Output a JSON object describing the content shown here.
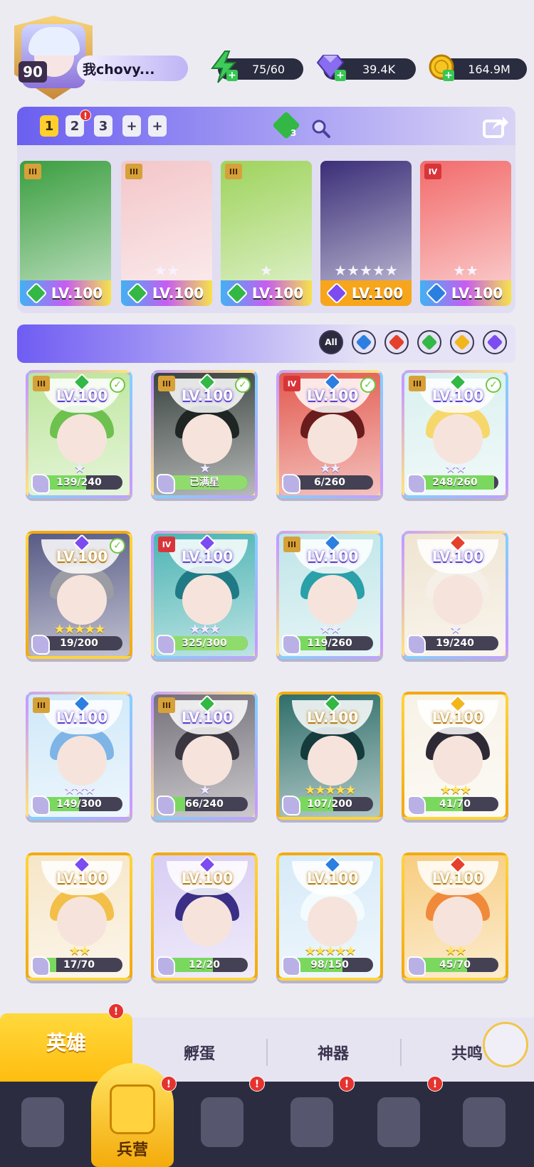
{
  "player": {
    "level": "90",
    "name": "我chovy..."
  },
  "resources": {
    "energy": "75/60",
    "gems": "39.4K",
    "coins": "164.9M"
  },
  "team": {
    "tabs": [
      "1",
      "2",
      "3",
      "+",
      "+"
    ],
    "active_tab": 0,
    "tab2_badge": "!",
    "element_chip_count": "3",
    "heroes": [
      {
        "rank": "III",
        "level": "LV.100",
        "stars": "",
        "element": "#33b846",
        "bg": "#3a9e3f"
      },
      {
        "rank": "III",
        "level": "LV.100",
        "stars": "★★",
        "element": "#33b846",
        "bg": "#f3c6c9"
      },
      {
        "rank": "III",
        "level": "LV.100",
        "stars": "★",
        "element": "#33b846",
        "bg": "#9ed35c"
      },
      {
        "rank": "",
        "level": "LV.100",
        "stars": "★★★★★",
        "element": "#7c4cf0",
        "bg": "#3b2e78"
      },
      {
        "rank": "IV",
        "level": "LV.100",
        "stars": "★★",
        "element": "#2b7fe0",
        "bg": "#f26b6b"
      }
    ]
  },
  "filters": {
    "all_label": "All",
    "elements": [
      "#2b7fe0",
      "#e5402c",
      "#33b846",
      "#f2b61c",
      "#7c4cf0"
    ]
  },
  "heroes": [
    {
      "rank": "III",
      "level": "LV.100",
      "stars": "★",
      "progress": "139/240",
      "fill": 0.58,
      "element": "#33b846",
      "check": true,
      "gold": false,
      "bg": "#bde59c",
      "hair": "#6ec14f"
    },
    {
      "rank": "III",
      "level": "LV.100",
      "stars": "★",
      "progress": "已满星",
      "fill": 1.0,
      "element": "#33b846",
      "check": true,
      "gold": false,
      "bg": "#3a4340",
      "hair": "#1e2522"
    },
    {
      "rank": "IV",
      "level": "LV.100",
      "stars": "★★",
      "progress": "6/260",
      "fill": 0.02,
      "element": "#2b7fe0",
      "check": true,
      "gold": false,
      "bg": "#e25a4f",
      "hair": "#6a1c1c"
    },
    {
      "rank": "III",
      "level": "LV.100",
      "stars": "★★",
      "progress": "248/260",
      "fill": 0.95,
      "element": "#33b846",
      "check": true,
      "gold": false,
      "bg": "#d9f0ef",
      "hair": "#f6d76b"
    },
    {
      "rank": "",
      "level": "LV.100",
      "stars": "★★★★★",
      "progress": "19/200",
      "fill": 0.1,
      "element": "#7c4cf0",
      "check": true,
      "gold": true,
      "bg": "#595b86",
      "hair": "#9c9ca4"
    },
    {
      "rank": "IV",
      "level": "LV.100",
      "stars": "★★★",
      "progress": "325/300",
      "fill": 1.0,
      "element": "#7c4cf0",
      "check": false,
      "gold": false,
      "bg": "#4db4b4",
      "hair": "#1f7a86"
    },
    {
      "rank": "III",
      "level": "LV.100",
      "stars": "★★",
      "progress": "119/260",
      "fill": 0.46,
      "element": "#2b7fe0",
      "check": false,
      "gold": false,
      "bg": "#bfe5e8",
      "hair": "#2aa0a8"
    },
    {
      "rank": "",
      "level": "LV.100",
      "stars": "★",
      "progress": "19/240",
      "fill": 0.08,
      "element": "#e5402c",
      "check": false,
      "gold": false,
      "bg": "#efe4d1",
      "hair": "#f4f0e8"
    },
    {
      "rank": "III",
      "level": "LV.100",
      "stars": "★★★",
      "progress": "149/300",
      "fill": 0.5,
      "element": "#2b7fe0",
      "check": false,
      "gold": false,
      "bg": "#cfe8f8",
      "hair": "#7fb5e6"
    },
    {
      "rank": "III",
      "level": "LV.100",
      "stars": "★",
      "progress": "66/240",
      "fill": 0.28,
      "element": "#33b846",
      "check": false,
      "gold": false,
      "bg": "#75707a",
      "hair": "#3a3640"
    },
    {
      "rank": "",
      "level": "LV.100",
      "stars": "★★★★★",
      "progress": "107/200",
      "fill": 0.54,
      "element": "#33b846",
      "check": false,
      "gold": true,
      "bg": "#2f6e6a",
      "hair": "#163b3c"
    },
    {
      "rank": "",
      "level": "LV.100",
      "stars": "★★★",
      "progress": "41/70",
      "fill": 0.59,
      "element": "#f2b61c",
      "check": false,
      "gold": true,
      "bg": "#f7f2e6",
      "hair": "#2e2a35"
    },
    {
      "rank": "",
      "level": "LV.100",
      "stars": "★★",
      "progress": "17/70",
      "fill": 0.24,
      "element": "#7c4cf0",
      "check": false,
      "gold": true,
      "bg": "#f6e6c8",
      "hair": "#f2c04a"
    },
    {
      "rank": "",
      "level": "LV.100",
      "stars": "",
      "progress": "12/20",
      "fill": 0.6,
      "element": "#7c4cf0",
      "check": false,
      "gold": true,
      "bg": "#d8cdf3",
      "hair": "#3a2e86"
    },
    {
      "rank": "",
      "level": "LV.100",
      "stars": "★★★★★",
      "progress": "98/150",
      "fill": 0.65,
      "element": "#2b7fe0",
      "check": false,
      "gold": true,
      "bg": "#d6eaf8",
      "hair": "#f4fbff"
    },
    {
      "rank": "",
      "level": "LV.100",
      "stars": "★★",
      "progress": "45/70",
      "fill": 0.64,
      "element": "#e5402c",
      "check": false,
      "gold": true,
      "bg": "#f7cd80",
      "hair": "#f08a3a"
    }
  ],
  "tabs": {
    "heroes": "英雄",
    "hatch": "孵蛋",
    "artifacts": "神器",
    "resonance": "共鸣",
    "badge": "!"
  },
  "nav": {
    "barracks": "兵营",
    "badge": "!"
  }
}
